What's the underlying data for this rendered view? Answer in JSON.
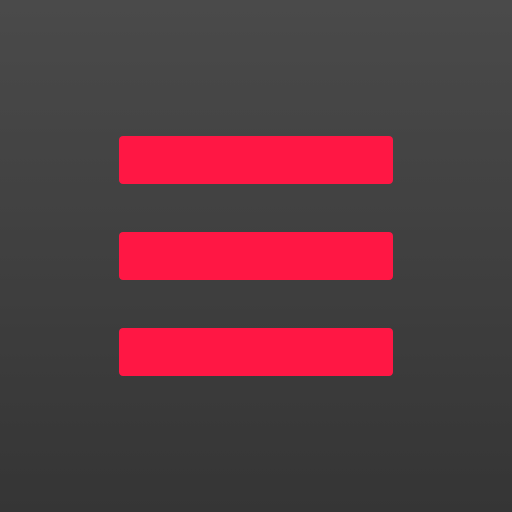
{
  "icon": {
    "name": "hamburger-menu-icon",
    "background_top": "#4a4a4a",
    "background_bottom": "#353535",
    "bar_color": "#ff1744",
    "bars": [
      "top",
      "middle",
      "bottom"
    ]
  }
}
